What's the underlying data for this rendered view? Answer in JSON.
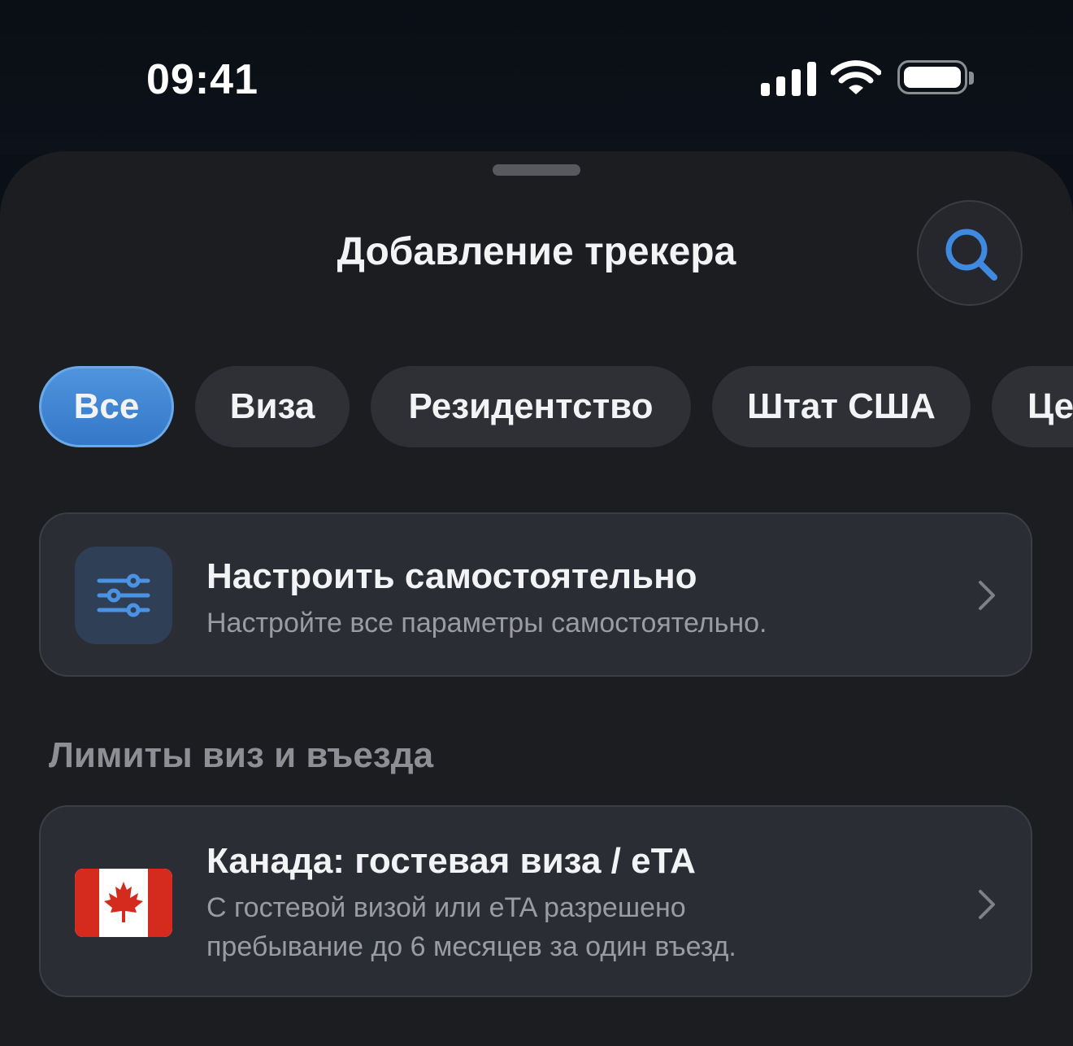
{
  "status_bar": {
    "time": "09:41"
  },
  "sheet": {
    "title": "Добавление трекера",
    "search_icon": "search-icon"
  },
  "filters": {
    "chips": [
      {
        "label": "Все",
        "active": true
      },
      {
        "label": "Виза",
        "active": false
      },
      {
        "label": "Резидентство",
        "active": false
      },
      {
        "label": "Штат США",
        "active": false
      },
      {
        "label": "Це",
        "active": false
      }
    ]
  },
  "custom_card": {
    "icon": "sliders-icon",
    "title": "Настроить самостоятельно",
    "subtitle": "Настройте все параметры самостоятельно."
  },
  "section": {
    "label": "Лимиты виз и въезда"
  },
  "canada_card": {
    "icon": "canada-flag-icon",
    "title": "Канада: гостевая виза / eTA",
    "subtitle_line1": "С гостевой визой или eTA разрешено",
    "subtitle_line2": "пребывание до 6 месяцев за один въезд."
  },
  "colors": {
    "accent": "#3f86d4",
    "background": "#1c1d21",
    "card": "#2a2d33"
  }
}
